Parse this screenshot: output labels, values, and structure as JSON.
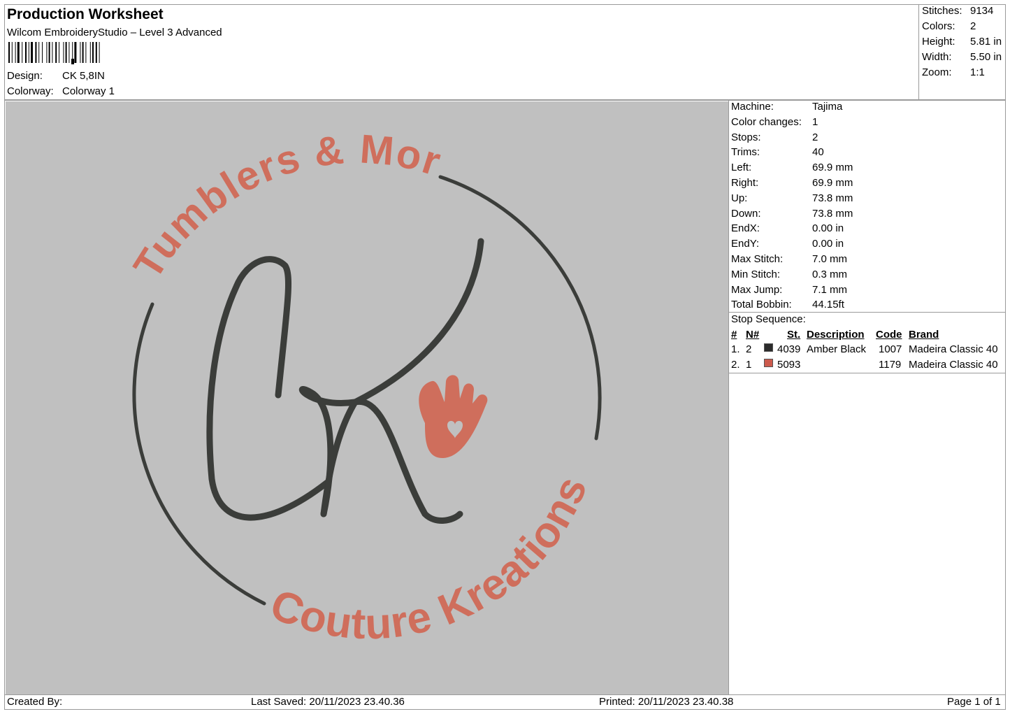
{
  "header": {
    "title": "Production Worksheet",
    "software": "Wilcom EmbroideryStudio – Level 3 Advanced",
    "design_label": "Design:",
    "design_value": "CK 5,8IN",
    "colorway_label": "Colorway:",
    "colorway_value": "Colorway 1"
  },
  "summary": [
    {
      "label": "Stitches:",
      "value": "9134"
    },
    {
      "label": "Colors:",
      "value": "2"
    },
    {
      "label": "Height:",
      "value": "5.81 in"
    },
    {
      "label": "Width:",
      "value": "5.50 in"
    },
    {
      "label": "Zoom:",
      "value": "1:1"
    }
  ],
  "machine_info": [
    {
      "label": "Machine:",
      "value": "Tajima"
    },
    {
      "label": "Color changes:",
      "value": "1"
    },
    {
      "label": "Stops:",
      "value": "2"
    },
    {
      "label": "Trims:",
      "value": "40"
    },
    {
      "label": "Left:",
      "value": "69.9 mm"
    },
    {
      "label": "Right:",
      "value": "69.9 mm"
    },
    {
      "label": "Up:",
      "value": "73.8 mm"
    },
    {
      "label": "Down:",
      "value": "73.8 mm"
    },
    {
      "label": "EndX:",
      "value": "0.00 in"
    },
    {
      "label": "EndY:",
      "value": "0.00 in"
    },
    {
      "label": "Max Stitch:",
      "value": "7.0 mm"
    },
    {
      "label": "Min Stitch:",
      "value": "0.3 mm"
    },
    {
      "label": "Max Jump:",
      "value": "7.1 mm"
    },
    {
      "label": "Total Bobbin:",
      "value": "44.15ft"
    }
  ],
  "stop_sequence": {
    "title": "Stop Sequence:",
    "columns": {
      "num": "#",
      "needle": "N#",
      "st": "St.",
      "description": "Description",
      "code": "Code",
      "brand": "Brand"
    },
    "rows": [
      {
        "num": "1.",
        "needle": "2",
        "color": "#2b2b2b",
        "st": "4039",
        "description": "Amber Black",
        "code": "1007",
        "brand": "Madeira Classic 40"
      },
      {
        "num": "2.",
        "needle": "1",
        "color": "#cc5a4c",
        "st": "5093",
        "description": "",
        "code": "1179",
        "brand": "Madeira Classic 40"
      }
    ]
  },
  "design_preview": {
    "top_text": "Tumblers & More",
    "bottom_text": "Couture Kreations",
    "monogram": "CK",
    "colors": {
      "background": "#c0c0c0",
      "dark_thread": "#3b3d3a",
      "salmon_thread": "#cf6e5c"
    }
  },
  "footer": {
    "created_by": "Created By:",
    "last_saved": "Last Saved: 20/11/2023 23.40.36",
    "printed": "Printed: 20/11/2023 23.40.38",
    "page": "Page 1 of 1"
  }
}
